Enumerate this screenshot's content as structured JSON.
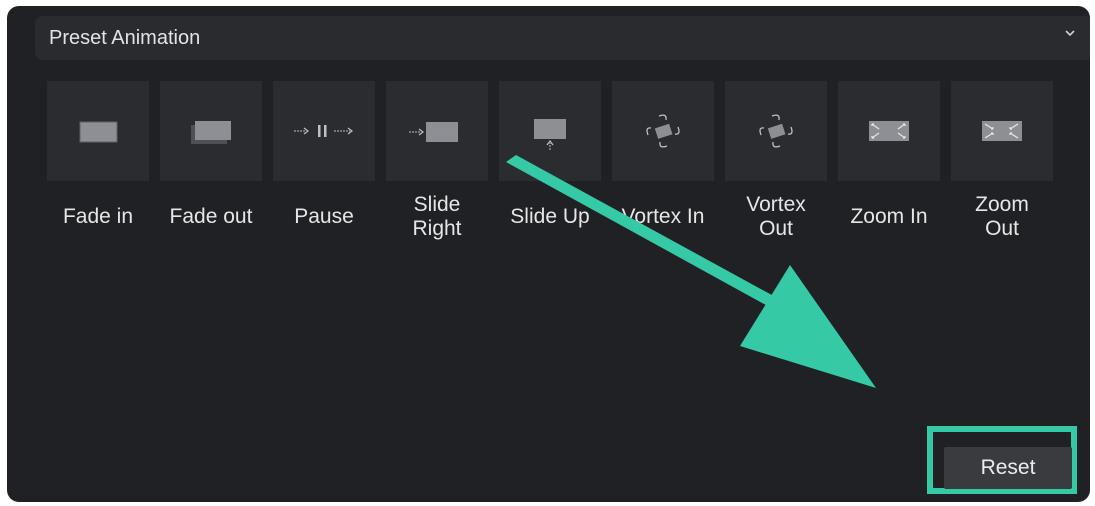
{
  "panel": {
    "title": "Preset Animation",
    "collapse_icon": "chevron-down-icon"
  },
  "presets": [
    {
      "label": "Fade in",
      "icon": "fade-in-icon"
    },
    {
      "label": "Fade out",
      "icon": "fade-out-icon"
    },
    {
      "label": "Pause",
      "icon": "pause-icon"
    },
    {
      "label": "Slide\nRight",
      "icon": "slide-right-icon"
    },
    {
      "label": "Slide Up",
      "icon": "slide-up-icon"
    },
    {
      "label": "Vortex In",
      "icon": "vortex-in-icon"
    },
    {
      "label": "Vortex\nOut",
      "icon": "vortex-out-icon"
    },
    {
      "label": "Zoom In",
      "icon": "zoom-in-icon"
    },
    {
      "label": "Zoom\nOut",
      "icon": "zoom-out-icon"
    }
  ],
  "reset": {
    "label": "Reset"
  },
  "colors": {
    "panel_bg": "#202124",
    "header_bg": "#2a2b2f",
    "thumb_bg": "#2b2c30",
    "accent": "#36c9a6"
  }
}
